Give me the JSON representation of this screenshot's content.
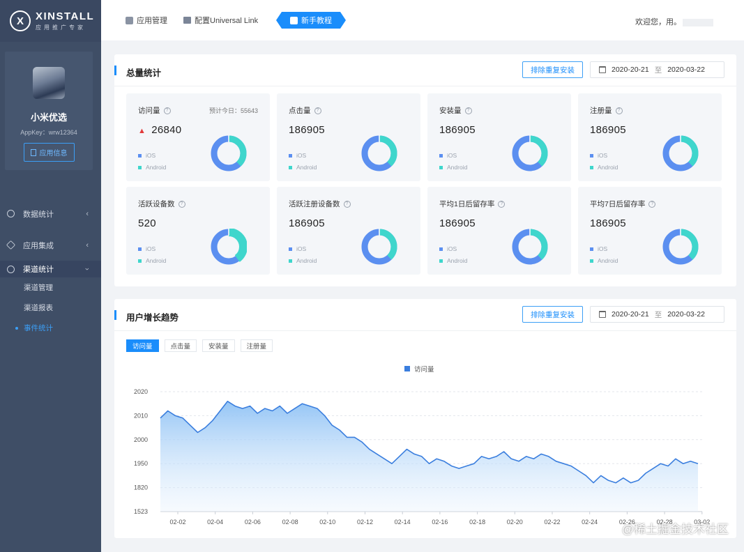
{
  "brand": {
    "name": "XINSTALL",
    "sub": "应用推广专家",
    "logo_letter": "X"
  },
  "profile": {
    "name": "小米优选",
    "appkey": "AppKey：wrw12364",
    "info_button": "应用信息"
  },
  "nav": {
    "items": [
      {
        "label": "数据统计",
        "icon": "chart-icon"
      },
      {
        "label": "应用集成",
        "icon": "box-icon"
      },
      {
        "label": "渠道统计",
        "icon": "channel-icon"
      }
    ],
    "sub_items": [
      "渠道管理",
      "渠道报表",
      "事件统计"
    ]
  },
  "topbar": {
    "app_manage": "应用管理",
    "universal_link": "配置Universal Link",
    "tutorial": "新手教程",
    "welcome": "欢迎您，用。"
  },
  "totals": {
    "title": "总量统计",
    "dedupe_button": "排除重复安装",
    "date_from": "2020-20-21",
    "date_sep": "至",
    "date_to": "2020-03-22",
    "forecast": "预计今日：55643",
    "legend_ios": "iOS",
    "legend_android": "Android",
    "stats": [
      {
        "label": "访问量",
        "value": "26840",
        "ios": 0.62,
        "android": 0.38,
        "arrow": "up"
      },
      {
        "label": "点击量",
        "value": "186905",
        "ios": 0.62,
        "android": 0.38
      },
      {
        "label": "安装量",
        "value": "186905",
        "ios": 0.62,
        "android": 0.38
      },
      {
        "label": "注册量",
        "value": "186905",
        "ios": 0.62,
        "android": 0.38
      },
      {
        "label": "活跃设备数",
        "value": "520",
        "ios": 0.6,
        "android": 0.4
      },
      {
        "label": "活跃注册设备数",
        "value": "186905",
        "ios": 0.62,
        "android": 0.38
      },
      {
        "label": "平均1日后留存率",
        "value": "186905",
        "ios": 0.62,
        "android": 0.38
      },
      {
        "label": "平均7日后留存率",
        "value": "186905",
        "ios": 0.62,
        "android": 0.38
      }
    ],
    "colors": {
      "ios": "#5b8ff0",
      "android": "#3fd6cc"
    }
  },
  "trend": {
    "title": "用户增长趋势",
    "dedupe_button": "排除重复安装",
    "date_from": "2020-20-21",
    "date_sep": "至",
    "date_to": "2020-03-22",
    "tabs": [
      "访问量",
      "点击量",
      "安装量",
      "注册量"
    ],
    "active_tab": 0
  },
  "chart_data": {
    "type": "area",
    "series": [
      {
        "name": "访问量",
        "color": "#3a7ede"
      }
    ],
    "y_tick_labels": [
      "1523",
      "1820",
      "1950",
      "2000",
      "2010",
      "2020"
    ],
    "x_tick_labels": [
      "02-02",
      "02-04",
      "02-06",
      "02-08",
      "02-10",
      "02-12",
      "02-14",
      "02-16",
      "02-18",
      "02-20",
      "02-22",
      "02-24",
      "02-26",
      "02-28",
      "03-02"
    ],
    "y_level": [
      3.9,
      4.2,
      4.0,
      3.9,
      3.6,
      3.3,
      3.5,
      3.8,
      4.2,
      4.6,
      4.4,
      4.3,
      4.4,
      4.1,
      4.3,
      4.2,
      4.4,
      4.1,
      4.3,
      4.5,
      4.4,
      4.3,
      4.0,
      3.6,
      3.4,
      3.1,
      3.1,
      2.9,
      2.6,
      2.4,
      2.2,
      2.0,
      2.3,
      2.6,
      2.4,
      2.3,
      2.0,
      2.2,
      2.1,
      1.9,
      1.8,
      1.9,
      2.0,
      2.3,
      2.2,
      2.3,
      2.5,
      2.2,
      2.1,
      2.3,
      2.2,
      2.4,
      2.3,
      2.1,
      2.0,
      1.9,
      1.7,
      1.5,
      1.2,
      1.5,
      1.3,
      1.2,
      1.4,
      1.2,
      1.3,
      1.6,
      1.8,
      2.0,
      1.9,
      2.2,
      2.0,
      2.1,
      2.0
    ],
    "ylim_levels": [
      0,
      5
    ],
    "grid": "horizontal-dashed",
    "legend_position": "top-center"
  },
  "watermark": "@稀土掘金技术社区"
}
